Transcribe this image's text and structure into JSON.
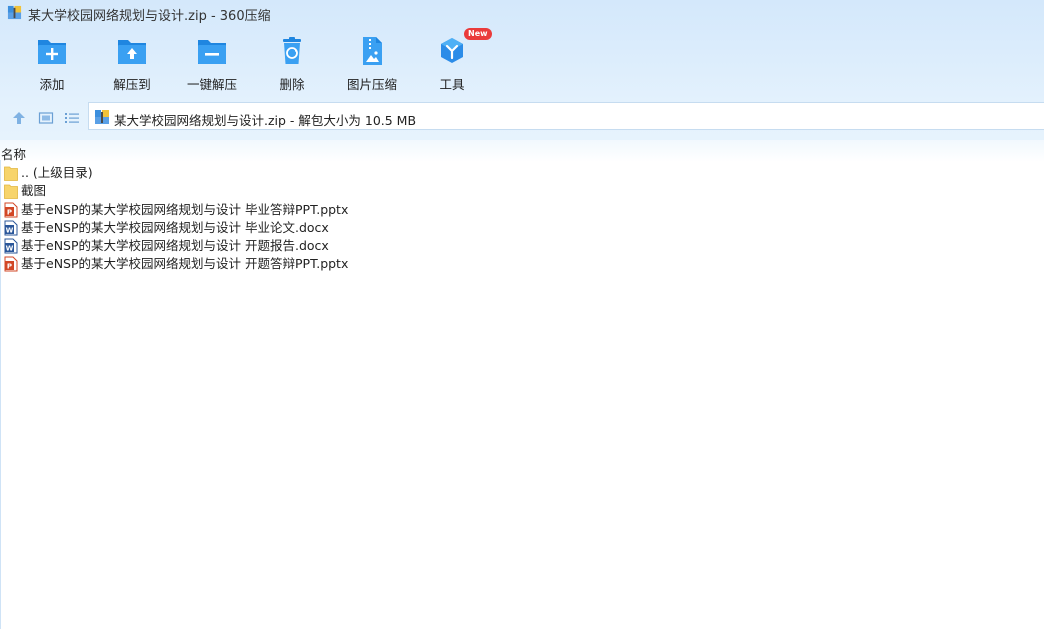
{
  "window": {
    "title": "某大学校园网络规划与设计.zip - 360压缩",
    "title_icon": "archive-icon"
  },
  "toolbar": {
    "buttons": [
      {
        "label": "添加",
        "icon": "add-icon"
      },
      {
        "label": "解压到",
        "icon": "extract-to-icon"
      },
      {
        "label": "一键解压",
        "icon": "one-click-extract-icon"
      },
      {
        "label": "删除",
        "icon": "delete-icon"
      },
      {
        "label": "图片压缩",
        "icon": "image-compress-icon"
      },
      {
        "label": "工具",
        "icon": "tools-icon",
        "badge": "New"
      }
    ]
  },
  "address": {
    "text": "某大学校园网络规划与设计.zip - 解包大小为 10.5 MB"
  },
  "list": {
    "column_name": "名称",
    "items": [
      {
        "name": ".. (上级目录)",
        "type": "folder"
      },
      {
        "name": "截图",
        "type": "folder"
      },
      {
        "name": "基于eNSP的某大学校园网络规划与设计 毕业答辩PPT.pptx",
        "type": "pptx"
      },
      {
        "name": "基于eNSP的某大学校园网络规划与设计 毕业论文.docx",
        "type": "docx"
      },
      {
        "name": "基于eNSP的某大学校园网络规划与设计 开题报告.docx",
        "type": "docx"
      },
      {
        "name": "基于eNSP的某大学校园网络规划与设计 开题答辩PPT.pptx",
        "type": "pptx"
      }
    ]
  },
  "colors": {
    "accent": "#2b8ce8",
    "folder": "#f7d46b",
    "pptx": "#d24726",
    "docx": "#2b579a",
    "badge": "#ea3b3b"
  }
}
